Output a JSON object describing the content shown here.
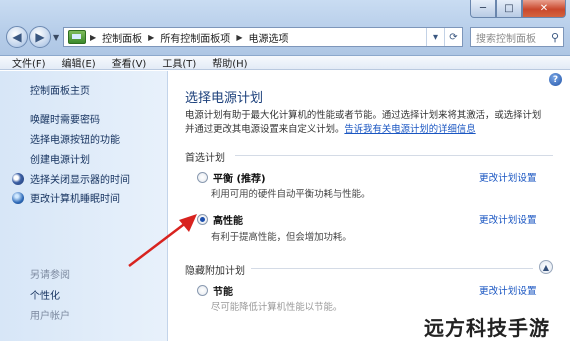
{
  "window": {
    "minimize": "─",
    "maximize": "□",
    "close": "✕"
  },
  "breadcrumbs": [
    "控制面板",
    "所有控制面板项",
    "电源选项"
  ],
  "search": {
    "placeholder": "搜索控制面板"
  },
  "menu": [
    "文件(F)",
    "编辑(E)",
    "查看(V)",
    "工具(T)",
    "帮助(H)"
  ],
  "sidebar": {
    "home": "控制面板主页",
    "links": [
      "唤醒时需要密码",
      "选择电源按钮的功能",
      "创建电源计划"
    ],
    "icon_links": [
      {
        "label": "选择关闭显示器的时间",
        "icon": "moon-icon"
      },
      {
        "label": "更改计算机睡眠时间",
        "icon": "globe-icon"
      }
    ],
    "see_also": "另请参阅",
    "see_also_links": [
      "个性化",
      "用户帐户"
    ]
  },
  "main": {
    "title": "选择电源计划",
    "desc_line1": "电源计划有助于最大化计算机的性能或者节能。通过选择计划来将其激活，或选择计划",
    "desc_line2": "并通过更改其电源设置来自定义计划。",
    "desc_link": "告诉我有关电源计划的详细信息",
    "preferred_label": "首选计划",
    "hidden_label": "隐藏附加计划",
    "change_link": "更改计划设置",
    "plans": [
      {
        "name": "平衡 (推荐)",
        "desc": "利用可用的硬件自动平衡功耗与性能。",
        "selected": false
      },
      {
        "name": "高性能",
        "desc": "有利于提高性能，但会增加功耗。",
        "selected": true
      },
      {
        "name": "节能",
        "desc": "尽可能降低计算机性能以节能。",
        "selected": false
      }
    ]
  },
  "watermark": "远方科技手游"
}
